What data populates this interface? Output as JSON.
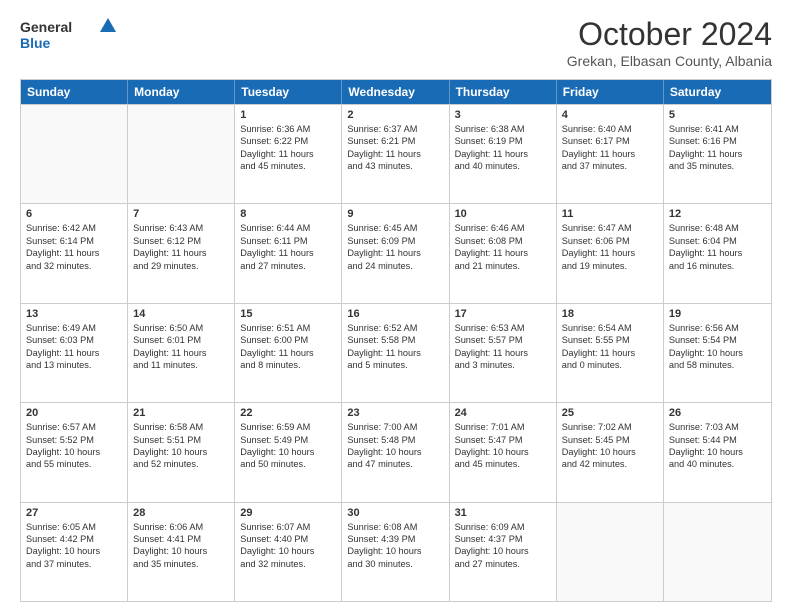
{
  "header": {
    "logo_general": "General",
    "logo_blue": "Blue",
    "month_title": "October 2024",
    "subtitle": "Grekan, Elbasan County, Albania"
  },
  "calendar": {
    "days": [
      "Sunday",
      "Monday",
      "Tuesday",
      "Wednesday",
      "Thursday",
      "Friday",
      "Saturday"
    ],
    "rows": [
      [
        {
          "day": "",
          "lines": []
        },
        {
          "day": "",
          "lines": []
        },
        {
          "day": "1",
          "lines": [
            "Sunrise: 6:36 AM",
            "Sunset: 6:22 PM",
            "Daylight: 11 hours",
            "and 45 minutes."
          ]
        },
        {
          "day": "2",
          "lines": [
            "Sunrise: 6:37 AM",
            "Sunset: 6:21 PM",
            "Daylight: 11 hours",
            "and 43 minutes."
          ]
        },
        {
          "day": "3",
          "lines": [
            "Sunrise: 6:38 AM",
            "Sunset: 6:19 PM",
            "Daylight: 11 hours",
            "and 40 minutes."
          ]
        },
        {
          "day": "4",
          "lines": [
            "Sunrise: 6:40 AM",
            "Sunset: 6:17 PM",
            "Daylight: 11 hours",
            "and 37 minutes."
          ]
        },
        {
          "day": "5",
          "lines": [
            "Sunrise: 6:41 AM",
            "Sunset: 6:16 PM",
            "Daylight: 11 hours",
            "and 35 minutes."
          ]
        }
      ],
      [
        {
          "day": "6",
          "lines": [
            "Sunrise: 6:42 AM",
            "Sunset: 6:14 PM",
            "Daylight: 11 hours",
            "and 32 minutes."
          ]
        },
        {
          "day": "7",
          "lines": [
            "Sunrise: 6:43 AM",
            "Sunset: 6:12 PM",
            "Daylight: 11 hours",
            "and 29 minutes."
          ]
        },
        {
          "day": "8",
          "lines": [
            "Sunrise: 6:44 AM",
            "Sunset: 6:11 PM",
            "Daylight: 11 hours",
            "and 27 minutes."
          ]
        },
        {
          "day": "9",
          "lines": [
            "Sunrise: 6:45 AM",
            "Sunset: 6:09 PM",
            "Daylight: 11 hours",
            "and 24 minutes."
          ]
        },
        {
          "day": "10",
          "lines": [
            "Sunrise: 6:46 AM",
            "Sunset: 6:08 PM",
            "Daylight: 11 hours",
            "and 21 minutes."
          ]
        },
        {
          "day": "11",
          "lines": [
            "Sunrise: 6:47 AM",
            "Sunset: 6:06 PM",
            "Daylight: 11 hours",
            "and 19 minutes."
          ]
        },
        {
          "day": "12",
          "lines": [
            "Sunrise: 6:48 AM",
            "Sunset: 6:04 PM",
            "Daylight: 11 hours",
            "and 16 minutes."
          ]
        }
      ],
      [
        {
          "day": "13",
          "lines": [
            "Sunrise: 6:49 AM",
            "Sunset: 6:03 PM",
            "Daylight: 11 hours",
            "and 13 minutes."
          ]
        },
        {
          "day": "14",
          "lines": [
            "Sunrise: 6:50 AM",
            "Sunset: 6:01 PM",
            "Daylight: 11 hours",
            "and 11 minutes."
          ]
        },
        {
          "day": "15",
          "lines": [
            "Sunrise: 6:51 AM",
            "Sunset: 6:00 PM",
            "Daylight: 11 hours",
            "and 8 minutes."
          ]
        },
        {
          "day": "16",
          "lines": [
            "Sunrise: 6:52 AM",
            "Sunset: 5:58 PM",
            "Daylight: 11 hours",
            "and 5 minutes."
          ]
        },
        {
          "day": "17",
          "lines": [
            "Sunrise: 6:53 AM",
            "Sunset: 5:57 PM",
            "Daylight: 11 hours",
            "and 3 minutes."
          ]
        },
        {
          "day": "18",
          "lines": [
            "Sunrise: 6:54 AM",
            "Sunset: 5:55 PM",
            "Daylight: 11 hours",
            "and 0 minutes."
          ]
        },
        {
          "day": "19",
          "lines": [
            "Sunrise: 6:56 AM",
            "Sunset: 5:54 PM",
            "Daylight: 10 hours",
            "and 58 minutes."
          ]
        }
      ],
      [
        {
          "day": "20",
          "lines": [
            "Sunrise: 6:57 AM",
            "Sunset: 5:52 PM",
            "Daylight: 10 hours",
            "and 55 minutes."
          ]
        },
        {
          "day": "21",
          "lines": [
            "Sunrise: 6:58 AM",
            "Sunset: 5:51 PM",
            "Daylight: 10 hours",
            "and 52 minutes."
          ]
        },
        {
          "day": "22",
          "lines": [
            "Sunrise: 6:59 AM",
            "Sunset: 5:49 PM",
            "Daylight: 10 hours",
            "and 50 minutes."
          ]
        },
        {
          "day": "23",
          "lines": [
            "Sunrise: 7:00 AM",
            "Sunset: 5:48 PM",
            "Daylight: 10 hours",
            "and 47 minutes."
          ]
        },
        {
          "day": "24",
          "lines": [
            "Sunrise: 7:01 AM",
            "Sunset: 5:47 PM",
            "Daylight: 10 hours",
            "and 45 minutes."
          ]
        },
        {
          "day": "25",
          "lines": [
            "Sunrise: 7:02 AM",
            "Sunset: 5:45 PM",
            "Daylight: 10 hours",
            "and 42 minutes."
          ]
        },
        {
          "day": "26",
          "lines": [
            "Sunrise: 7:03 AM",
            "Sunset: 5:44 PM",
            "Daylight: 10 hours",
            "and 40 minutes."
          ]
        }
      ],
      [
        {
          "day": "27",
          "lines": [
            "Sunrise: 6:05 AM",
            "Sunset: 4:42 PM",
            "Daylight: 10 hours",
            "and 37 minutes."
          ]
        },
        {
          "day": "28",
          "lines": [
            "Sunrise: 6:06 AM",
            "Sunset: 4:41 PM",
            "Daylight: 10 hours",
            "and 35 minutes."
          ]
        },
        {
          "day": "29",
          "lines": [
            "Sunrise: 6:07 AM",
            "Sunset: 4:40 PM",
            "Daylight: 10 hours",
            "and 32 minutes."
          ]
        },
        {
          "day": "30",
          "lines": [
            "Sunrise: 6:08 AM",
            "Sunset: 4:39 PM",
            "Daylight: 10 hours",
            "and 30 minutes."
          ]
        },
        {
          "day": "31",
          "lines": [
            "Sunrise: 6:09 AM",
            "Sunset: 4:37 PM",
            "Daylight: 10 hours",
            "and 27 minutes."
          ]
        },
        {
          "day": "",
          "lines": []
        },
        {
          "day": "",
          "lines": []
        }
      ]
    ]
  }
}
